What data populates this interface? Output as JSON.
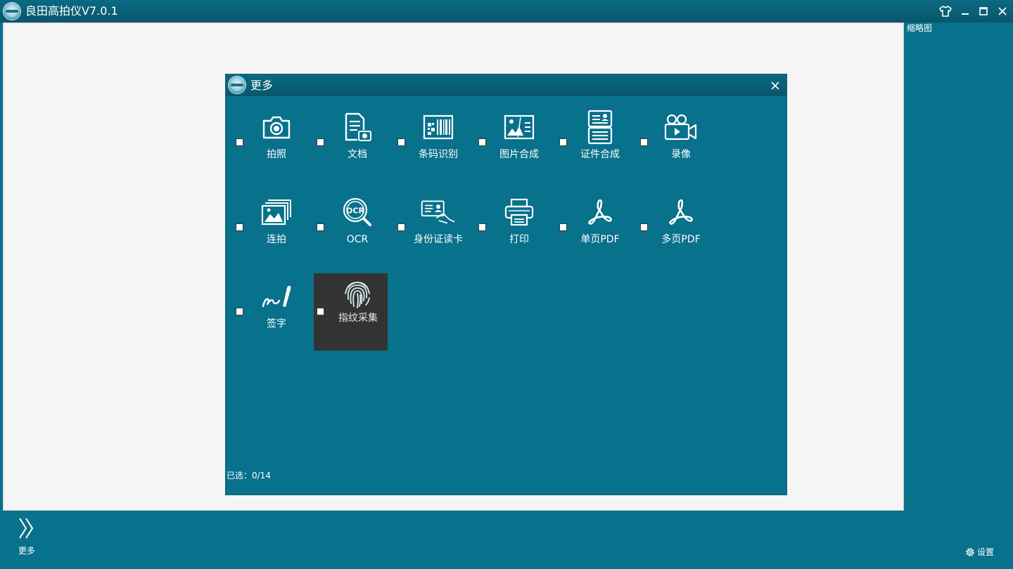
{
  "app": {
    "title": "良田高拍仪V7.0.1"
  },
  "window_controls": [
    "skin-icon",
    "minimize-icon",
    "maximize-icon",
    "close-icon"
  ],
  "sidebar": {
    "thumbnails_label": "缩略图"
  },
  "bottom": {
    "more_label": "更多",
    "settings_label": "设置"
  },
  "dialog": {
    "title": "更多",
    "tiles": [
      {
        "label": "拍照",
        "icon": "camera-icon",
        "checked": false
      },
      {
        "label": "文档",
        "icon": "document-icon",
        "checked": false
      },
      {
        "label": "条码识别",
        "icon": "barcode-icon",
        "checked": false
      },
      {
        "label": "图片合成",
        "icon": "image-merge-icon",
        "checked": false
      },
      {
        "label": "证件合成",
        "icon": "id-merge-icon",
        "checked": false
      },
      {
        "label": "录像",
        "icon": "video-camera-icon",
        "checked": false
      },
      {
        "label": "连拍",
        "icon": "burst-photos-icon",
        "checked": false
      },
      {
        "label": "OCR",
        "icon": "ocr-icon",
        "checked": false
      },
      {
        "label": "身份证读卡",
        "icon": "id-card-reader-icon",
        "checked": false
      },
      {
        "label": "打印",
        "icon": "printer-icon",
        "checked": false
      },
      {
        "label": "单页PDF",
        "icon": "pdf-icon",
        "checked": false
      },
      {
        "label": "多页PDF",
        "icon": "pdf-icon",
        "checked": false
      },
      {
        "label": "签字",
        "icon": "signature-icon",
        "checked": false
      },
      {
        "label": "指纹采集",
        "icon": "fingerprint-icon",
        "checked": false,
        "highlighted": true
      }
    ],
    "selected_count": "已选：0/14"
  },
  "colors": {
    "background": "#08718c",
    "titlebar": "#08566b",
    "viewport": "#f5f5f5",
    "highlight_tile": "#333333"
  }
}
